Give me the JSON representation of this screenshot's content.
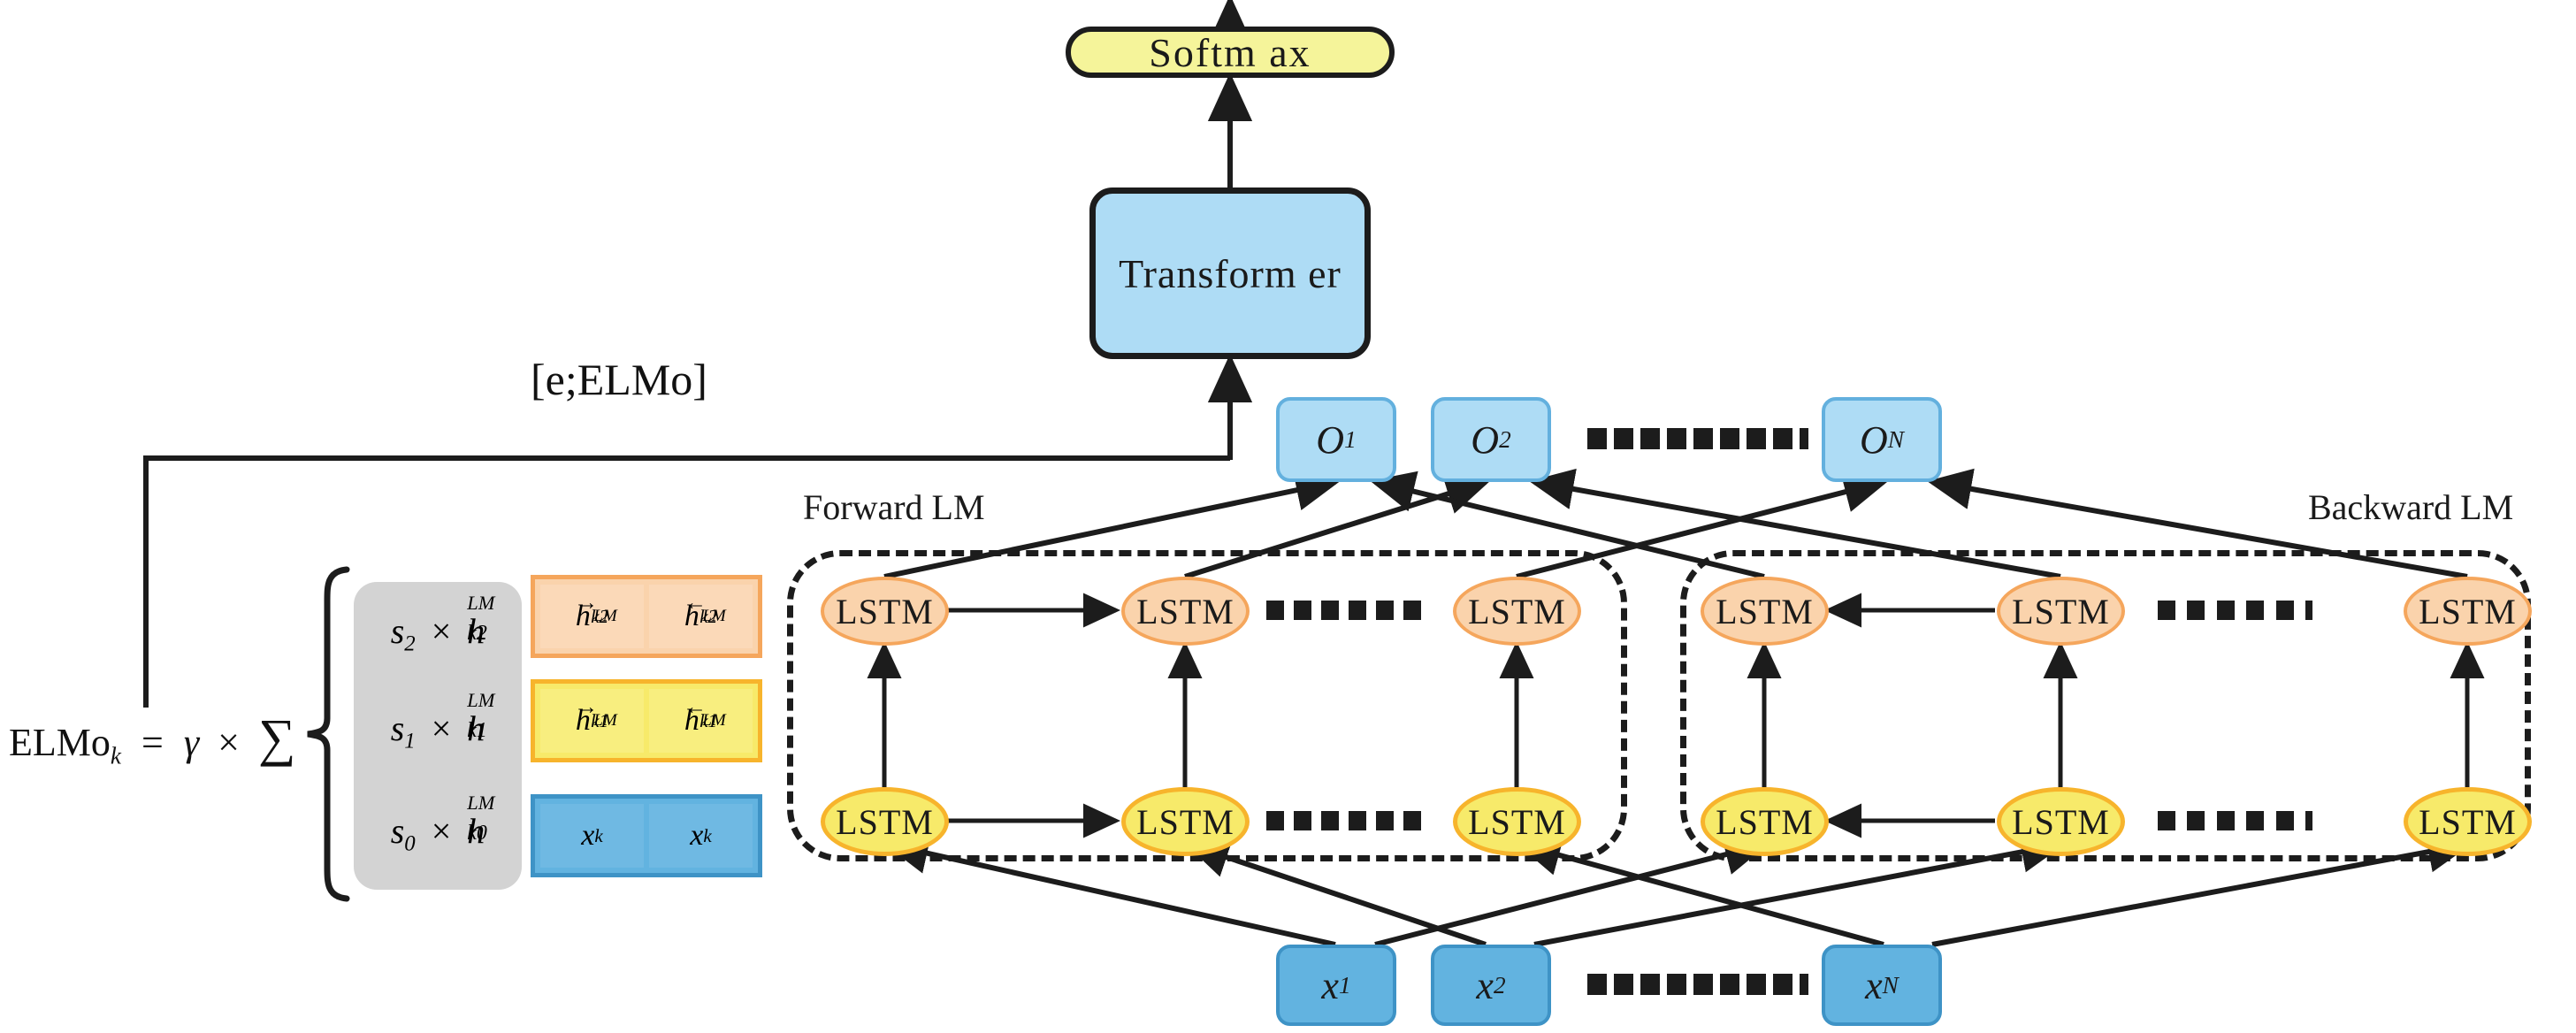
{
  "diagram": {
    "title_nodes": {
      "softmax": "Softm ax",
      "transformer": "Transform er"
    },
    "concat_label": "[e;ELMo]",
    "forward_lm_label": "Forward LM",
    "backward_lm_label": "Backward LM",
    "lstm_label": "LSTM",
    "formula": {
      "name": "ELMo",
      "name_sub": "k",
      "equals": "=",
      "gamma": "γ",
      "times": "×",
      "sigma": "∑"
    },
    "weight_rows": [
      {
        "s": "s",
        "s_sub": "2",
        "times": "×",
        "h": "h",
        "h_sup": "LM",
        "h_sub": "k2"
      },
      {
        "s": "s",
        "s_sub": "1",
        "times": "×",
        "h": "h",
        "h_sup": "LM",
        "h_sub": "k1"
      },
      {
        "s": "s",
        "s_sub": "0",
        "times": "×",
        "h": "h",
        "h_sup": "LM",
        "h_sub": "k0"
      }
    ],
    "representation_rows": [
      {
        "color": "orange",
        "left": {
          "sym": "h",
          "arrow": "→",
          "sup": "LM",
          "sub": "k2"
        },
        "right": {
          "sym": "h",
          "arrow": "←",
          "sup": "LM",
          "sub": "k2"
        }
      },
      {
        "color": "yellow",
        "left": {
          "sym": "h",
          "arrow": "→",
          "sup": "LM",
          "sub": "k1"
        },
        "right": {
          "sym": "h",
          "arrow": "←",
          "sup": "LM",
          "sub": "k1"
        }
      },
      {
        "color": "blue",
        "left": {
          "sym": "x",
          "arrow": "",
          "sup": "",
          "sub": "k"
        },
        "right": {
          "sym": "x",
          "arrow": "",
          "sup": "",
          "sub": "k"
        }
      }
    ],
    "outputs": [
      {
        "sym": "O",
        "sub": "1"
      },
      {
        "sym": "O",
        "sub": "2"
      },
      {
        "sym": "O",
        "sub": "N"
      }
    ],
    "inputs": [
      {
        "sym": "x",
        "sub": "1"
      },
      {
        "sym": "x",
        "sub": "2"
      },
      {
        "sym": "x",
        "sub": "N"
      }
    ],
    "colors": {
      "softmax_fill": "#f5f49a",
      "transformer_fill": "#aedcf5",
      "output_fill": "#aedcf5",
      "input_fill": "#62b3e0",
      "lstm_top_fill": "#fad3ac",
      "lstm_top_stroke": "#f5a65c",
      "lstm_bottom_fill": "#f7ea6a",
      "lstm_bottom_stroke": "#f7b42c",
      "weight_panel_fill": "#d3d3d3",
      "stroke": "#1c1c1c"
    }
  }
}
